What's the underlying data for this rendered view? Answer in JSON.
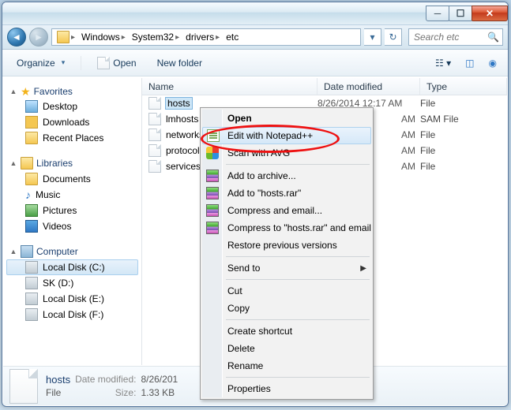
{
  "breadcrumbs": [
    "Windows",
    "System32",
    "drivers",
    "etc"
  ],
  "search_placeholder": "Search etc",
  "toolbar": {
    "organize": "Organize",
    "open": "Open",
    "newfolder": "New folder"
  },
  "columns": {
    "name": "Name",
    "date": "Date modified",
    "type": "Type"
  },
  "sidebar": {
    "favorites": {
      "label": "Favorites",
      "items": [
        "Desktop",
        "Downloads",
        "Recent Places"
      ]
    },
    "libraries": {
      "label": "Libraries",
      "items": [
        "Documents",
        "Music",
        "Pictures",
        "Videos"
      ]
    },
    "computer": {
      "label": "Computer",
      "items": [
        "Local Disk (C:)",
        "SK (D:)",
        "Local Disk (E:)",
        "Local Disk (F:)"
      ]
    }
  },
  "files": [
    {
      "name": "hosts",
      "date": "8/26/2014 12:17 AM",
      "type": "File",
      "selected": true
    },
    {
      "name": "lmhosts",
      "date_tail": "AM",
      "type": "SAM File",
      "selected": false
    },
    {
      "name": "networks",
      "date_tail": "AM",
      "type": "File",
      "selected": false
    },
    {
      "name": "protocol",
      "date_tail": "AM",
      "type": "File",
      "selected": false
    },
    {
      "name": "services",
      "date_tail": "AM",
      "type": "File",
      "selected": false
    }
  ],
  "context_menu": {
    "open": "Open",
    "edit_npp": "Edit with Notepad++",
    "scan_avg": "Scan with AVG",
    "add_archive": "Add to archive...",
    "add_rar": "Add to \"hosts.rar\"",
    "compress_email": "Compress and email...",
    "compress_to_email": "Compress to \"hosts.rar\" and email",
    "restore": "Restore previous versions",
    "send_to": "Send to",
    "cut": "Cut",
    "copy": "Copy",
    "shortcut": "Create shortcut",
    "delete": "Delete",
    "rename": "Rename",
    "properties": "Properties"
  },
  "details": {
    "name": "hosts",
    "date_label": "Date modified:",
    "date_value": "8/26/201",
    "type_label": "File",
    "size_label": "Size:",
    "size_value": "1.33 KB"
  }
}
